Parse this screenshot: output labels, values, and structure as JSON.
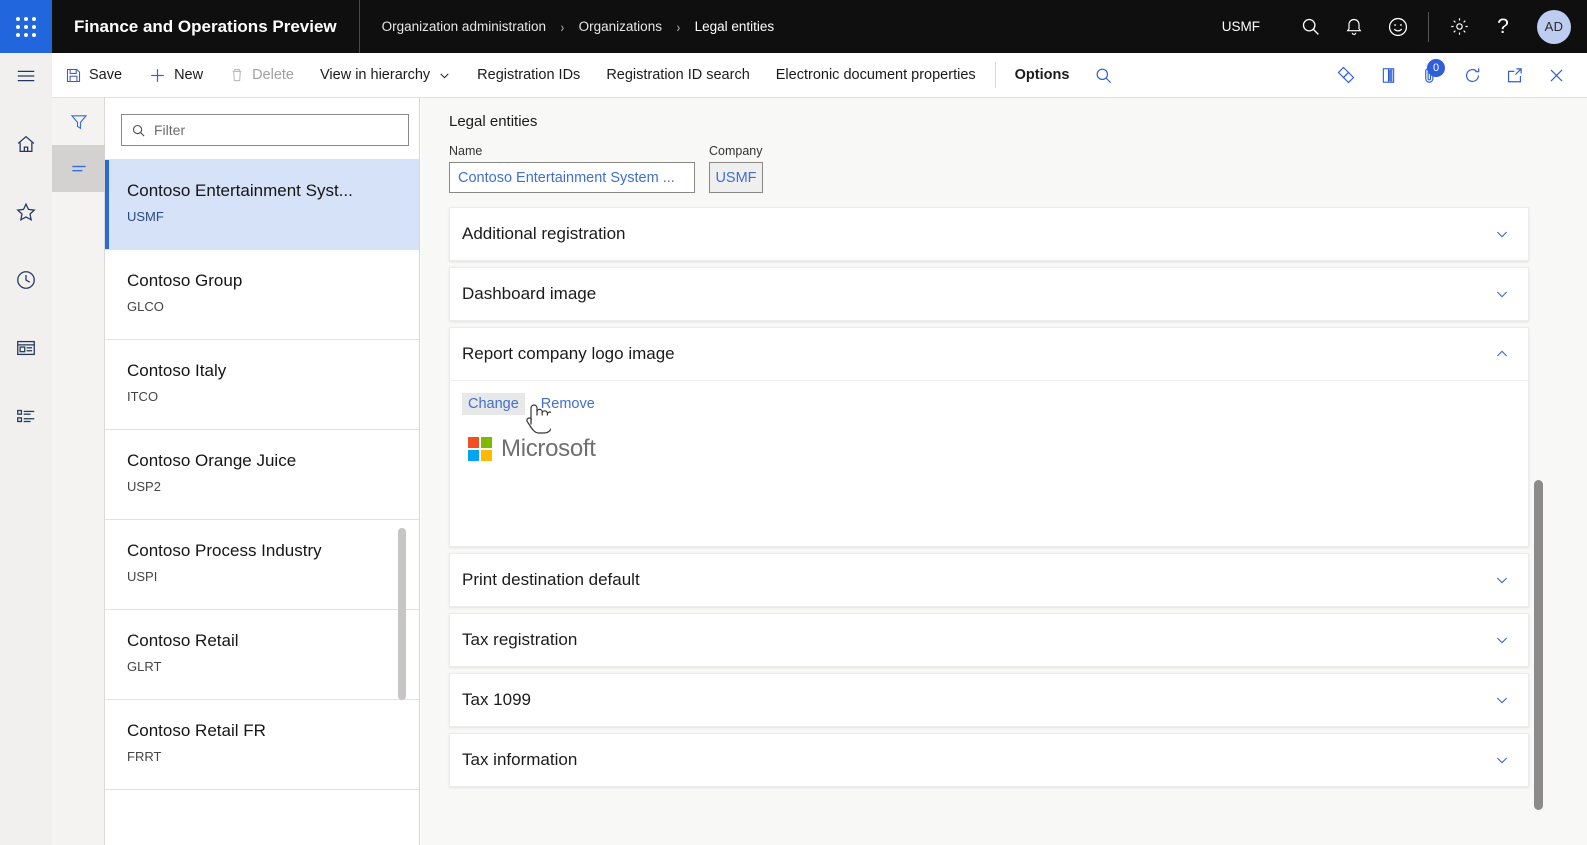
{
  "topbar": {
    "waffle_label": "app-launcher",
    "app_title": "Finance and Operations Preview",
    "breadcrumb": [
      {
        "label": "Organization administration"
      },
      {
        "label": "Organizations"
      },
      {
        "label": "Legal entities"
      }
    ],
    "breadcrumb_separator": "›",
    "company_code": "USMF",
    "icons": [
      {
        "name": "search-icon",
        "glyph": "search"
      },
      {
        "name": "notifications-bell-icon",
        "glyph": "bell"
      },
      {
        "name": "feedback-smiley-icon",
        "glyph": "smiley"
      },
      {
        "name": "settings-gear-icon",
        "glyph": "gear"
      },
      {
        "name": "help-icon",
        "glyph": "?"
      }
    ],
    "avatar_initials": "AD",
    "accent_color": "#2266dd",
    "background_color": "#0f0f0f"
  },
  "commandbar": {
    "items": [
      {
        "label": "Save",
        "icon": "save-icon",
        "disabled": false,
        "bold": false
      },
      {
        "label": "New",
        "icon": "plus-icon",
        "disabled": false,
        "bold": false
      },
      {
        "label": "Delete",
        "icon": "trash-icon",
        "disabled": true,
        "bold": false
      },
      {
        "label": "View in hierarchy",
        "icon": "chevron-down-icon",
        "disabled": false,
        "bold": false
      },
      {
        "label": "Registration IDs",
        "icon": "",
        "disabled": false,
        "bold": false
      },
      {
        "label": "Registration ID search",
        "icon": "",
        "disabled": false,
        "bold": false
      },
      {
        "label": "Electronic document properties",
        "icon": "",
        "disabled": false,
        "bold": false
      },
      {
        "label": "Options",
        "icon": "",
        "disabled": false,
        "bold": true
      }
    ],
    "search_icon": "search-icon",
    "right_icons": [
      {
        "name": "personalize-diamond-icon"
      },
      {
        "name": "open-in-office-icon"
      },
      {
        "name": "attachments-icon",
        "badge": "0"
      },
      {
        "name": "refresh-icon"
      },
      {
        "name": "popout-icon"
      },
      {
        "name": "close-icon"
      }
    ]
  },
  "rail": {
    "items": [
      {
        "name": "hamburger-menu-icon",
        "label": "Expand the navigation pane"
      },
      {
        "name": "home-icon",
        "label": "Home"
      },
      {
        "name": "favorites-star-icon",
        "label": "Favorites"
      },
      {
        "name": "recent-clock-icon",
        "label": "Recent"
      },
      {
        "name": "workspaces-icon",
        "label": "Workspaces"
      },
      {
        "name": "modules-list-icon",
        "label": "Modules"
      }
    ]
  },
  "panel_rail": {
    "items": [
      {
        "name": "filter-funnel-icon",
        "label": "Filter",
        "active": false
      },
      {
        "name": "list-view-icon",
        "label": "List view",
        "active": true
      }
    ]
  },
  "list": {
    "filter_placeholder": "Filter",
    "filter_value": "",
    "filter_icon": "search-icon",
    "items": [
      {
        "name": "Contoso Entertainment Syst...",
        "code": "USMF",
        "selected": true
      },
      {
        "name": "Contoso Group",
        "code": "GLCO",
        "selected": false
      },
      {
        "name": "Contoso Italy",
        "code": "ITCO",
        "selected": false
      },
      {
        "name": "Contoso Orange Juice",
        "code": "USP2",
        "selected": false
      },
      {
        "name": "Contoso Process Industry",
        "code": "USPI",
        "selected": false
      },
      {
        "name": "Contoso Retail",
        "code": "GLRT",
        "selected": false
      },
      {
        "name": "Contoso Retail FR",
        "code": "FRRT",
        "selected": false
      }
    ]
  },
  "main": {
    "page_title": "Legal entities",
    "fields": [
      {
        "label": "Name",
        "value": "Contoso Entertainment System ...",
        "readonly": false
      },
      {
        "label": "Company",
        "value": "USMF",
        "readonly": true
      }
    ],
    "sections": [
      {
        "title": "Additional registration",
        "expanded": false
      },
      {
        "title": "Dashboard image",
        "expanded": false
      },
      {
        "title": "Report company logo image",
        "expanded": true
      },
      {
        "title": "Print destination default",
        "expanded": false
      },
      {
        "title": "Tax registration",
        "expanded": false
      },
      {
        "title": "Tax 1099",
        "expanded": false
      },
      {
        "title": "Tax information",
        "expanded": false
      }
    ],
    "logo_section": {
      "change_label": "Change",
      "remove_label": "Remove",
      "logo_text": "Microsoft",
      "logo_colors": [
        "#f25022",
        "#7fba00",
        "#00a4ef",
        "#ffb900"
      ]
    }
  }
}
